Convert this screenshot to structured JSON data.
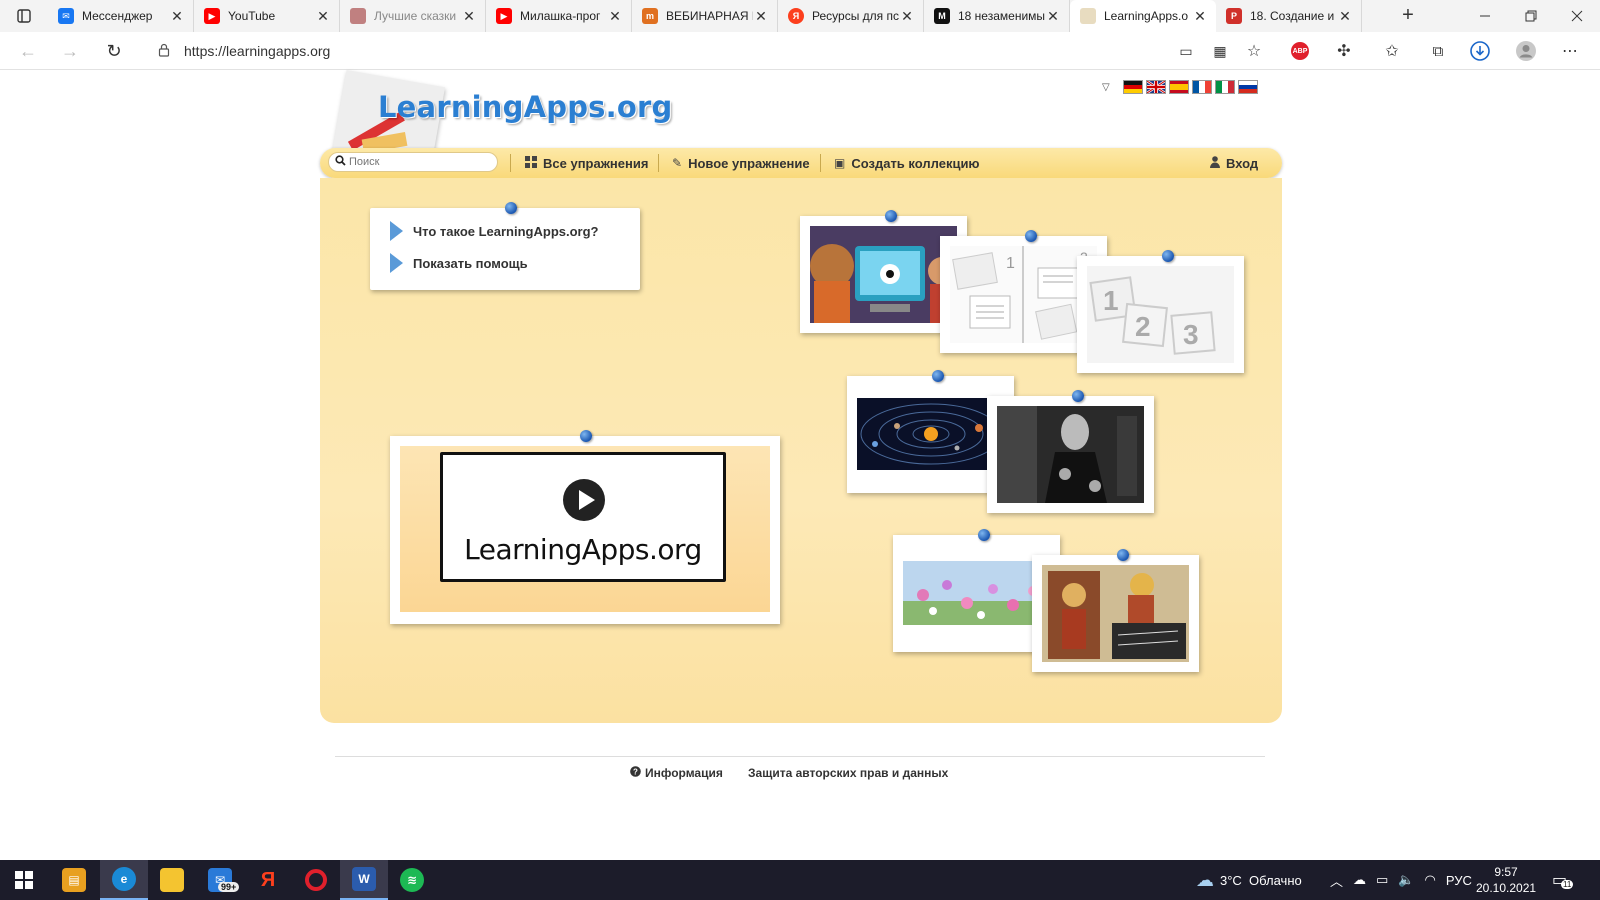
{
  "browser": {
    "tabs": [
      {
        "title": "Мессенджер",
        "icon": "messenger-icon",
        "color": "#1877f2"
      },
      {
        "title": "YouTube",
        "icon": "youtube-icon",
        "color": "#ff0000"
      },
      {
        "title": "Лучшие сказки",
        "icon": "book-icon",
        "color": "#c08080"
      },
      {
        "title": "Милашка-прог",
        "icon": "youtube-icon",
        "color": "#ff0000"
      },
      {
        "title": "ВЕБИНАРНАЯ К",
        "icon": "webinar-icon",
        "color": "#e07020"
      },
      {
        "title": "Ресурсы для пс",
        "icon": "yandex-icon",
        "color": "#fc3f1d"
      },
      {
        "title": "18 незаменимы",
        "icon": "medium-icon",
        "color": "#111111"
      },
      {
        "title": "LearningApps.o",
        "icon": "learningapps-icon",
        "color": "#d0b080"
      },
      {
        "title": "18. Создание и",
        "icon": "pdf-icon",
        "color": "#d0302a"
      }
    ],
    "active_tab": 7,
    "url": "https://learningapps.org"
  },
  "site": {
    "logo": "LearningApps.org",
    "search_placeholder": "Поиск",
    "menu": {
      "all": "Все упражнения",
      "new": "Новое упражнение",
      "collection": "Создать коллекцию",
      "login": "Вход"
    },
    "languages": [
      "de",
      "en",
      "es",
      "fr",
      "it",
      "ru"
    ],
    "info_links": [
      "Что такое LearningApps.org?",
      "Показать помощь"
    ],
    "video_title": "LearningApps.org",
    "footer": {
      "info": "Информация",
      "privacy": "Защита авторских прав и данных"
    }
  },
  "taskbar": {
    "mail_badge": "99+",
    "weather": "3°C  Облачно",
    "lang": "РУС",
    "time": "9:57",
    "date": "20.10.2021",
    "notifications": "11"
  },
  "colors": {
    "accent": "#2b7fd2",
    "board": "#fde9b6",
    "menubar": "#f9d97a"
  }
}
